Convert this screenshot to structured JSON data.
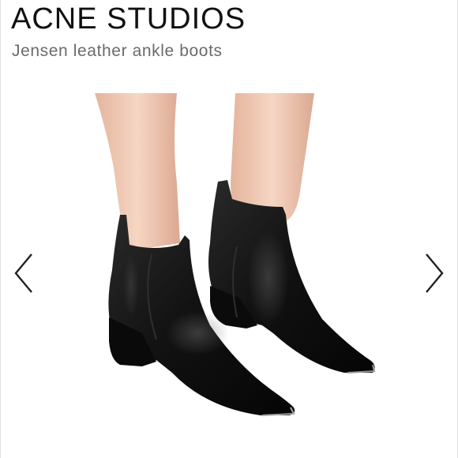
{
  "product": {
    "brand": "ACNE STUDIOS",
    "name": "Jensen leather ankle boots"
  },
  "carousel": {
    "prev_icon": "chevron-left-icon",
    "next_icon": "chevron-right-icon"
  },
  "colors": {
    "brand_text": "#111111",
    "subtitle_text": "#6b6b6b",
    "background": "#ffffff",
    "boot_leather": "#141414",
    "skin": "#efc7b2"
  }
}
